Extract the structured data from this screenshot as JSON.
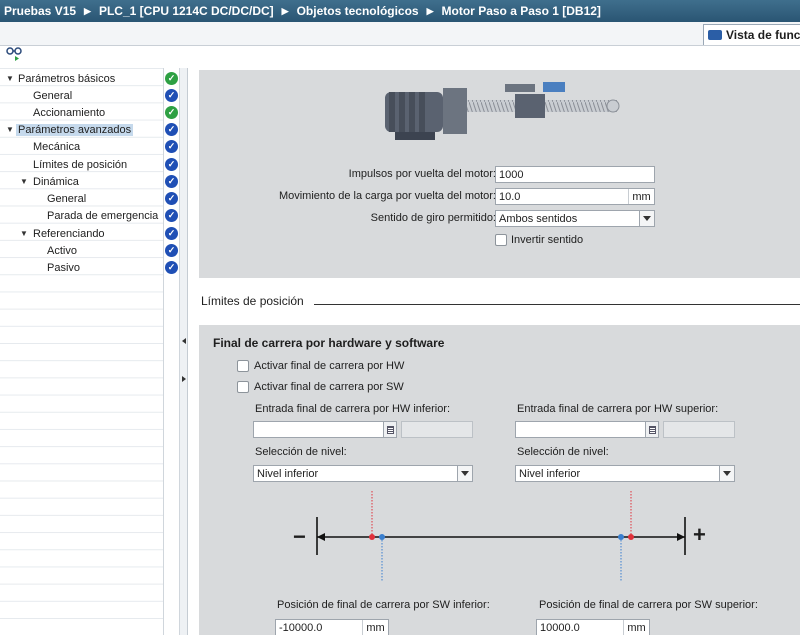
{
  "breadcrumb": [
    "Pruebas V15",
    "PLC_1 [CPU 1214C DC/DC/DC]",
    "Objetos tecnológicos",
    "Motor Paso a Paso 1 [DB12]"
  ],
  "view_tab": "Vista de func",
  "icons": {
    "toolbar": "glasses-icon",
    "ok": "check-icon",
    "motor": "motor-screw-illustration"
  },
  "colors": {
    "header": "#2f5d7c",
    "panel": "#d8dadc",
    "status_ok_green": "#2ea043",
    "status_ok_blue": "#1f4fb5",
    "selection": "#c5d9ec"
  },
  "tree": {
    "items": [
      {
        "label": "Parámetros básicos",
        "toggle": "▼",
        "status": "green"
      },
      {
        "label": "General",
        "toggle": "",
        "status": "blue"
      },
      {
        "label": "Accionamiento",
        "toggle": "",
        "status": "green"
      },
      {
        "label": "Parámetros avanzados",
        "toggle": "▼",
        "status": "blue"
      },
      {
        "label": "Mecánica",
        "toggle": "",
        "status": "blue"
      },
      {
        "label": "Límites de posición",
        "toggle": "",
        "status": "blue"
      },
      {
        "label": "Dinámica",
        "toggle": "▼",
        "status": "blue"
      },
      {
        "label": "General",
        "toggle": "",
        "status": "blue"
      },
      {
        "label": "Parada de emergencia",
        "toggle": "",
        "status": "blue"
      },
      {
        "label": "Referenciando",
        "toggle": "▼",
        "status": "blue"
      },
      {
        "label": "Activo",
        "toggle": "",
        "status": "blue"
      },
      {
        "label": "Pasivo",
        "toggle": "",
        "status": "blue"
      }
    ]
  },
  "mechanics": {
    "pulses_label": "Impulsos por vuelta del motor:",
    "pulses_value": "1000",
    "load_label": "Movimiento de la carga por vuelta del motor:",
    "load_value": "10.0",
    "load_unit": "mm",
    "direction_label": "Sentido de giro permitido:",
    "direction_value": "Ambos sentidos",
    "invert_label": "Invertir sentido"
  },
  "limits": {
    "section_title": "Límites de posición",
    "box_title": "Final de carrera por hardware y software",
    "hw_check_label": "Activar final de carrera por HW",
    "sw_check_label": "Activar final de carrera por SW",
    "hw_lower_label": "Entrada final de carrera por HW inferior:",
    "hw_upper_label": "Entrada final de carrera por HW superior:",
    "level_label_left": "Selección de nivel:",
    "level_label_right": "Selección de nivel:",
    "level_left_value": "Nivel inferior",
    "level_right_value": "Nivel inferior",
    "minus_symbol": "−",
    "plus_symbol": "+",
    "sw_lower_label": "Posición de final de carrera por SW inferior:",
    "sw_upper_label": "Posición de final de carrera por SW superior:",
    "sw_lower_value": "-10000.0",
    "sw_upper_value": "10000.0",
    "sw_lower_unit": "mm",
    "sw_upper_unit": "mm"
  }
}
